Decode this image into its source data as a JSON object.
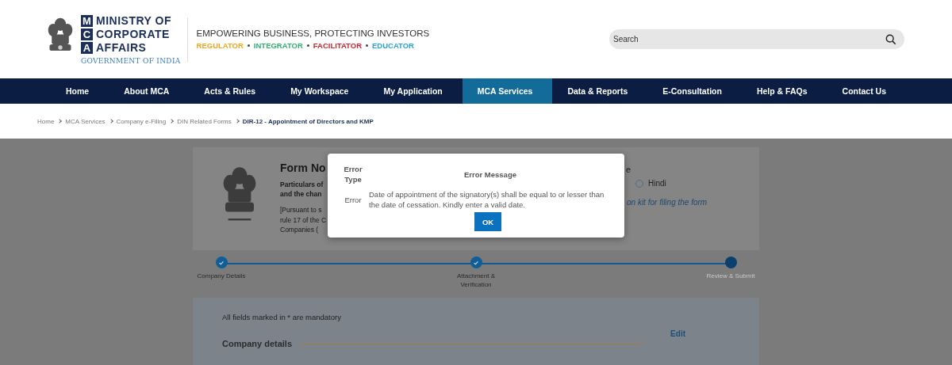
{
  "header": {
    "logo_letters": [
      "M",
      "C",
      "A"
    ],
    "logo_lines": [
      "MINISTRY OF",
      "CORPORATE",
      "AFFAIRS"
    ],
    "government": "GOVERNMENT OF INDIA",
    "tagline": "EMPOWERING BUSINESS, PROTECTING INVESTORS",
    "roles": [
      {
        "label": "REGULATOR",
        "color": "#f2a51a"
      },
      {
        "label": "INTEGRATOR",
        "color": "#2fb36f"
      },
      {
        "label": "FACILITATOR",
        "color": "#d3232f"
      },
      {
        "label": "EDUCATOR",
        "color": "#27a3d4"
      }
    ],
    "search": {
      "placeholder": "Search"
    }
  },
  "nav": [
    {
      "label": "Home",
      "selected": false
    },
    {
      "label": "About MCA",
      "selected": false
    },
    {
      "label": "Acts & Rules",
      "selected": false
    },
    {
      "label": "My Workspace",
      "selected": false
    },
    {
      "label": "My Application",
      "selected": false
    },
    {
      "label": "MCA Services",
      "selected": true
    },
    {
      "label": "Data & Reports",
      "selected": false
    },
    {
      "label": "E-Consultation",
      "selected": false
    },
    {
      "label": "Help & FAQs",
      "selected": false
    },
    {
      "label": "Contact Us",
      "selected": false
    }
  ],
  "breadcrumb": {
    "links": [
      "Home",
      "MCA Services",
      "Company e-Filing",
      "DIN Related Forms"
    ],
    "current": "DIR-12 - Appointment of Directors and KMP"
  },
  "form_card": {
    "title": "Form No",
    "subtitle_lines": [
      "Particulars of",
      "and the chan"
    ],
    "note_lines": [
      "[Pursuant to s",
      "rule 17 of the C",
      "Companies ("
    ],
    "language_label": "e",
    "language_option": {
      "label": "Hindi",
      "selected": false
    },
    "kit_link": "on kit for filing the form"
  },
  "stepper": [
    {
      "label": "Company Details",
      "completed": true
    },
    {
      "label": "Attachment & Verification",
      "completed": true
    },
    {
      "label": "Review & Submit",
      "completed": false
    }
  ],
  "panel": {
    "mandatory_note": "All fields marked in  * are mandatory",
    "edit_link": "Edit",
    "section_title": "Company details"
  },
  "dialog": {
    "columns": [
      "Error Type",
      "Error Message"
    ],
    "type": "Error",
    "message": "Date of appointment of the signatory(s) shall be equal to or lesser than the date of cessation. Kindly enter a valid date.",
    "button": "OK"
  }
}
